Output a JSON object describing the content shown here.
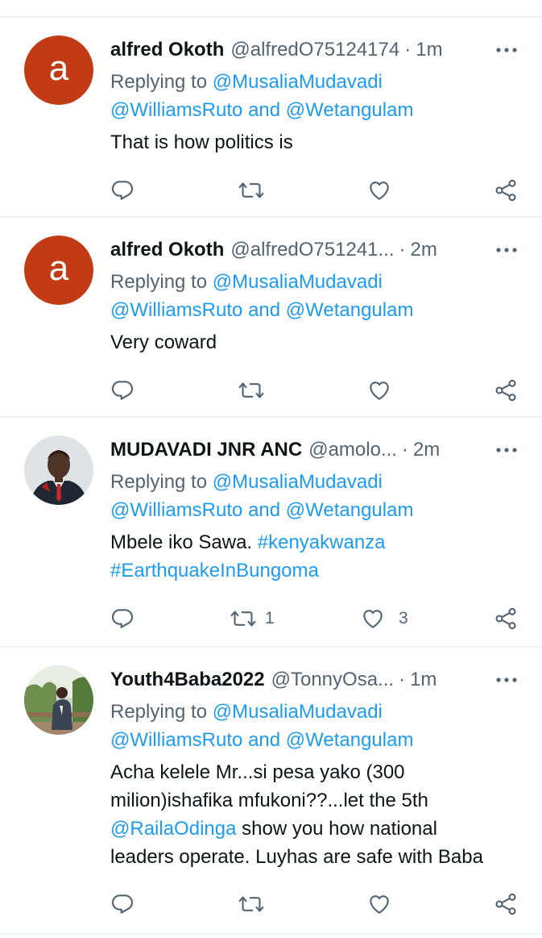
{
  "colors": {
    "link": "#1d9bf0",
    "secondary_text": "#536471",
    "avatar_letter_bg": "#c23b14",
    "divider": "#eff3f4"
  },
  "tweets": [
    {
      "avatar_type": "letter",
      "avatar_letter": "a",
      "name": "alfred Okoth",
      "handle": "@alfredO75124174",
      "time": "1m",
      "replying_prefix": "Replying to",
      "replying_to_1": "@MusaliaMudavadi",
      "replying_to_2": "@WilliamsRuto",
      "replying_and": "and",
      "replying_to_3": "@Wetangulam",
      "text": "That is how politics is",
      "retweets": "",
      "likes": ""
    },
    {
      "avatar_type": "letter",
      "avatar_letter": "a",
      "name": "alfred Okoth",
      "handle": "@alfredO751241...",
      "time": "2m",
      "replying_prefix": "Replying to",
      "replying_to_1": "@MusaliaMudavadi",
      "replying_to_2": "@WilliamsRuto",
      "replying_and": "and",
      "replying_to_3": "@Wetangulam",
      "text": "Very coward",
      "retweets": "",
      "likes": ""
    },
    {
      "avatar_type": "photo",
      "name": "MUDAVADI JNR ANC",
      "handle": "@amolo...",
      "time": "2m",
      "replying_prefix": "Replying to",
      "replying_to_1": "@MusaliaMudavadi",
      "replying_to_2": "@WilliamsRuto",
      "replying_and": "and",
      "replying_to_3": "@Wetangulam",
      "text": "Mbele iko Sawa.",
      "hashtag_1": "#kenyakwanza",
      "hashtag_2": "#EarthquakeInBungoma",
      "retweets": "1",
      "likes": "3"
    },
    {
      "avatar_type": "photo",
      "name": "Youth4Baba2022",
      "handle": "@TonnyOsa...",
      "time": "1m",
      "replying_prefix": "Replying to",
      "replying_to_1": "@MusaliaMudavadi",
      "replying_to_2": "@WilliamsRuto",
      "replying_and": "and",
      "replying_to_3": "@Wetangulam",
      "text_line_1": "Acha kelele Mr...si pesa yako (300",
      "text_line_2": "milion)ishafika mfukoni??...let the 5th",
      "mention": "@RailaOdinga",
      "text_line_3_rest": " show you how national",
      "text_line_4": "leaders operate. Luyhas are safe with Baba",
      "retweets": "",
      "likes": ""
    }
  ],
  "icons": {
    "separator": "·",
    "more": "more-horizontal-icon",
    "reply": "reply-icon",
    "retweet": "retweet-icon",
    "like": "heart-icon",
    "share": "share-icon"
  }
}
